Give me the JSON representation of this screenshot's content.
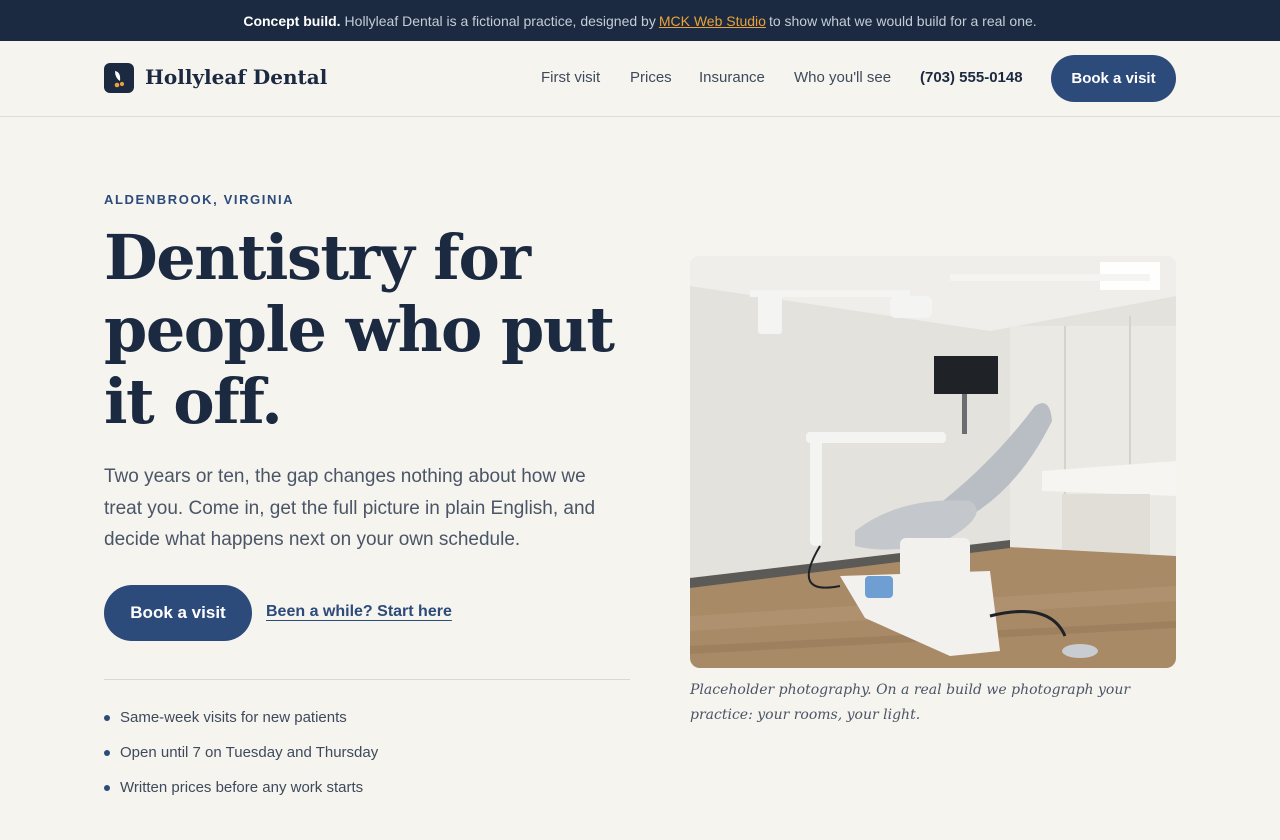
{
  "banner": {
    "strong": "Concept build.",
    "text_before": "Hollyleaf Dental is a fictional practice, designed by",
    "link": "MCK Web Studio",
    "text_after": "to show what we would build for a real one."
  },
  "header": {
    "brand": "Hollyleaf Dental",
    "nav": [
      "First visit",
      "Prices",
      "Insurance",
      "Who you'll see"
    ],
    "phone": "(703) 555-0148",
    "cta": "Book a visit"
  },
  "hero": {
    "eyebrow": "ALDENBROOK, VIRGINIA",
    "headline": "Dentistry for people who put it off.",
    "lede": "Two years or ten, the gap changes nothing about how we treat you. Come in, get the full picture in plain English, and decide what happens next on your own schedule.",
    "cta_primary": "Book a visit",
    "cta_secondary": "Been a while? Start here",
    "features": [
      "Same-week visits for new patients",
      "Open until 7 on Tuesday and Thursday",
      "Written prices before any work starts"
    ],
    "photo_caption": "Placeholder photography. On a real build we photograph your practice: your rooms, your light."
  },
  "colors": {
    "navy": "#1b2a40",
    "accent_blue": "#2c4a7a",
    "banner_link": "#e9a23b",
    "background": "#f6f4ef"
  },
  "icons": {
    "logo": "hollyleaf-logo-icon",
    "bullet": "bullet-dot-icon"
  }
}
